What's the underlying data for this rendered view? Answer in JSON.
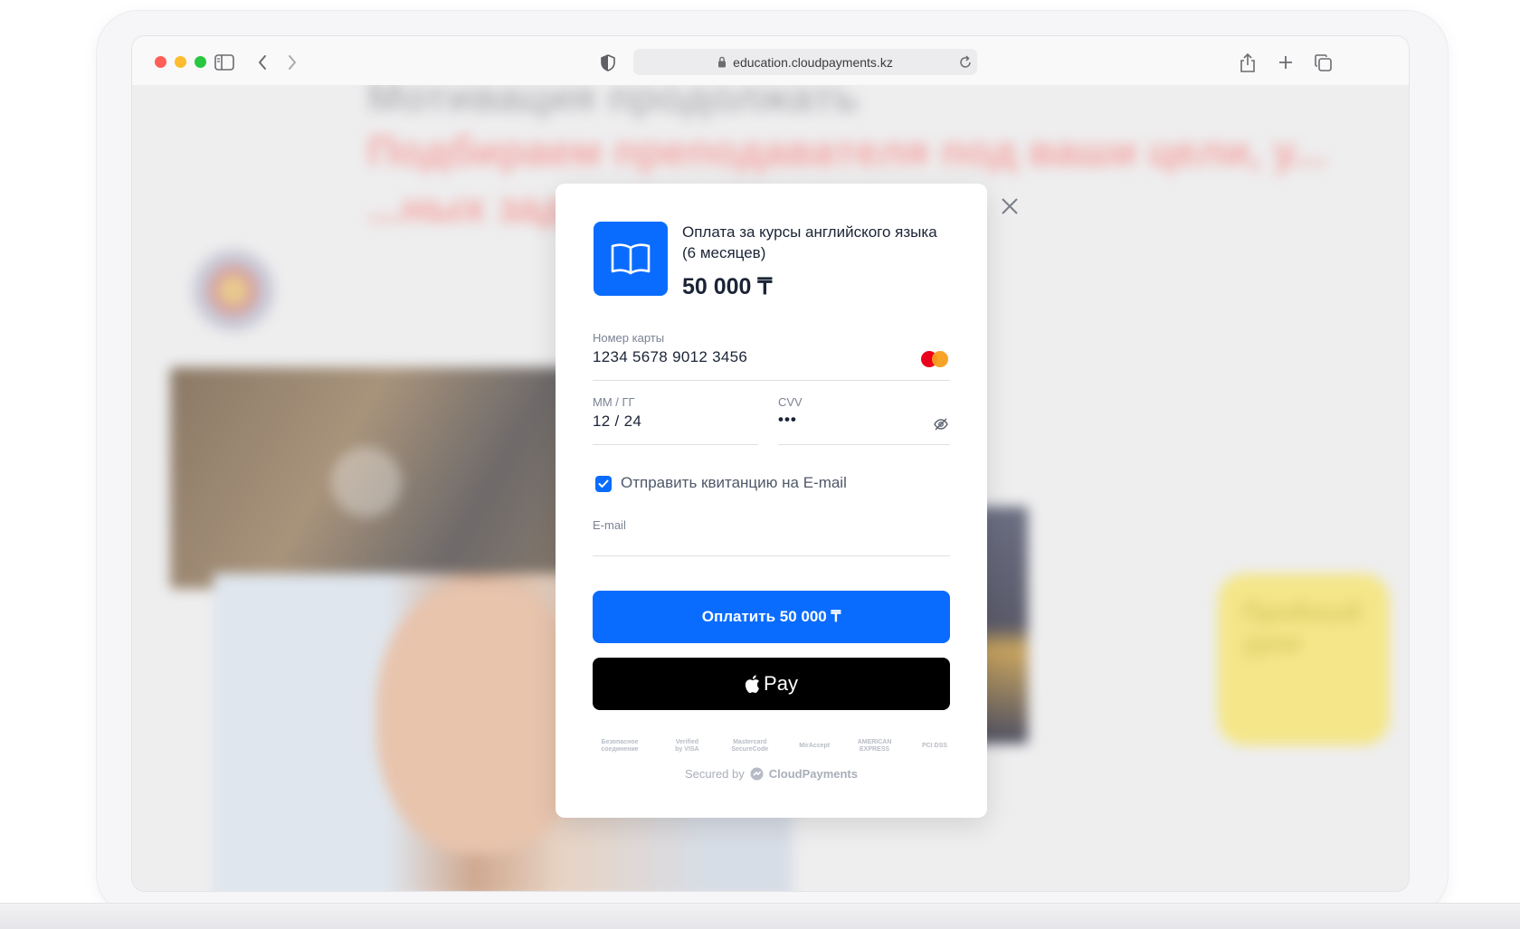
{
  "browser": {
    "url": "education.cloudpayments.kz"
  },
  "background_page": {
    "heading": "Мотивация продолжать",
    "red_text": "Подбираем преподавателя под ваши цели, у... ...ных заданиях по ваш...",
    "trial_card": "Пробный урок"
  },
  "payment": {
    "order_title": "Оплата за курсы английского языка (6 месяцев)",
    "amount": "50 000 ₸",
    "card_number_label": "Номер карты",
    "card_number_value": "1234 5678 9012 3456",
    "expiry_label": "ММ / ГГ",
    "expiry_value": "12 / 24",
    "cvv_label": "CVV",
    "cvv_value": "•••",
    "receipt_checkbox_label": "Отправить квитанцию на E-mail",
    "receipt_checked": true,
    "email_label": "E-mail",
    "email_value": "",
    "pay_button": "Оплатить 50 000 ₸",
    "apple_pay_label": "Pay",
    "secured_prefix": "Secured by",
    "secured_brand": "CloudPayments",
    "badges": [
      "Безопасное соединение",
      "Verified by VISA",
      "Mastercard SecureCode",
      "MirAccept",
      "AMERICAN EXPRESS",
      "PCI DSS"
    ]
  },
  "colors": {
    "accent": "#0a6cff",
    "apple_pay": "#000000"
  }
}
